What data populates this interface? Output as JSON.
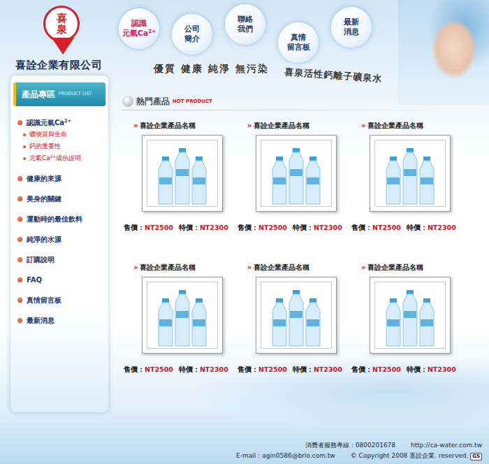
{
  "company": {
    "logo_text": "喜泉",
    "name": "喜詮企業有限公司"
  },
  "nav": [
    {
      "lines": [
        "認識",
        "元氣Ca"
      ],
      "sup": "2+"
    },
    {
      "lines": [
        "公司",
        "簡介"
      ]
    },
    {
      "lines": [
        "聯絡",
        "我們"
      ]
    },
    {
      "lines": [
        "真情",
        "留言板"
      ]
    },
    {
      "lines": [
        "最新",
        "消息"
      ]
    }
  ],
  "tagline": {
    "left": "優質 健康 純淨 無污染",
    "right": "喜泉活性鈣離子礦泉水"
  },
  "sidebar": {
    "title": "產品專區",
    "subtitle": "PRODUCT LIST",
    "items": [
      {
        "label": "認識元氣Ca",
        "sup": "2+",
        "children": [
          {
            "label": "礦物質與生命"
          },
          {
            "label": "鈣的重要性"
          },
          {
            "label": "元氣Ca",
            "sup": "2+",
            "suffix": "成份說明"
          }
        ]
      },
      {
        "label": "健康的來源"
      },
      {
        "label": "美身的關鍵"
      },
      {
        "label": "運動時的最佳飲料"
      },
      {
        "label": "純淨的水源"
      },
      {
        "label": "訂購說明"
      },
      {
        "label": "FAQ"
      },
      {
        "label": "真情留言板"
      },
      {
        "label": "最新消息"
      }
    ]
  },
  "section": {
    "title": "熱門產品",
    "subtitle": "HOT PRODUCT"
  },
  "products": [
    {
      "marker": "»",
      "name": "喜詮企業產品名稱",
      "price_label": "售價：",
      "price": "NT2500",
      "sale_label": "特價：",
      "sale": "NT2300"
    },
    {
      "marker": "»",
      "name": "喜詮企業產品名稱",
      "price_label": "售價：",
      "price": "NT2500",
      "sale_label": "特價：",
      "sale": "NT2300"
    },
    {
      "marker": "»",
      "name": "喜詮企業產品名稱",
      "price_label": "售價：",
      "price": "NT2500",
      "sale_label": "特價：",
      "sale": "NT2300"
    },
    {
      "marker": "»",
      "name": "喜詮企業產品名稱",
      "price_label": "售價：",
      "price": "NT2500",
      "sale_label": "特價：",
      "sale": "NT2300"
    },
    {
      "marker": "»",
      "name": "喜詮企業產品名稱",
      "price_label": "售價：",
      "price": "NT2500",
      "sale_label": "特價：",
      "sale": "NT2300"
    },
    {
      "marker": "»",
      "name": "喜詮企業產品名稱",
      "price_label": "售價：",
      "price": "NT2500",
      "sale_label": "特價：",
      "sale": "NT2300"
    }
  ],
  "footer": {
    "hotline": "消費者服務專線：0800201678",
    "url": "http://ca-water.com.tw",
    "email": "E-mail：agin0586@brio.com.tw",
    "copyright": "© Copyright 2008 喜詮企業. reserved.",
    "badge": "GS"
  }
}
